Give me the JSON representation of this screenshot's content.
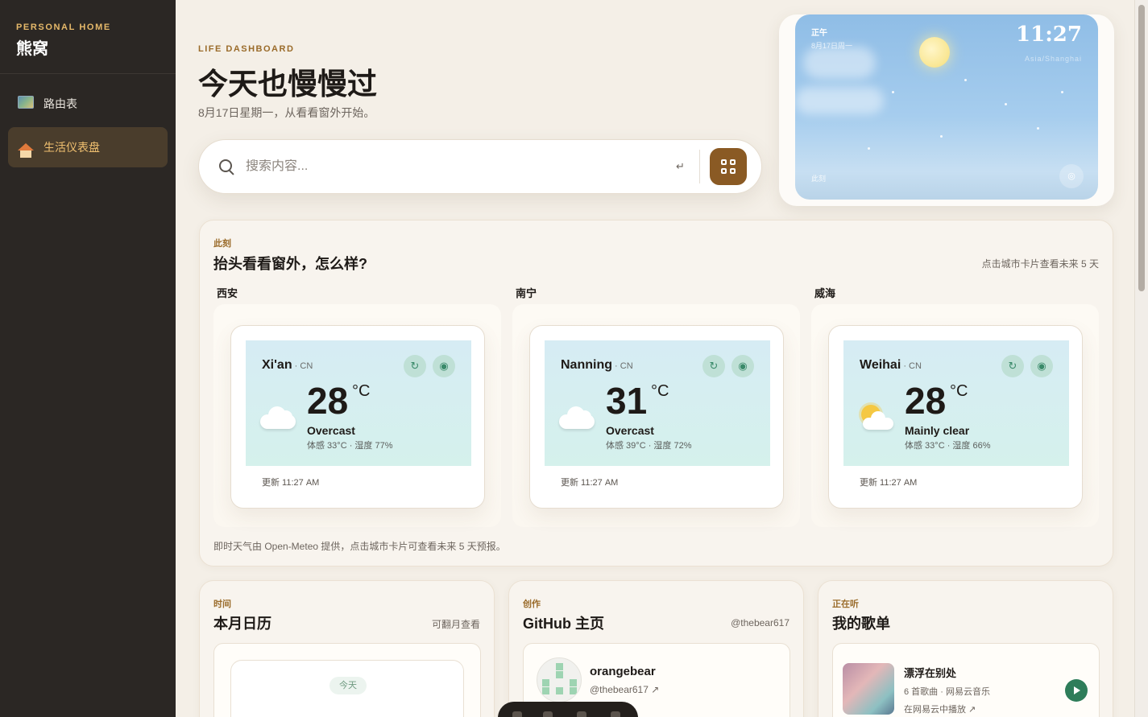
{
  "sidebar": {
    "brand_sub": "PERSONAL HOME",
    "brand_name": "熊窝",
    "items": [
      {
        "label": "路由表",
        "icon": "map-icon",
        "active": false
      },
      {
        "label": "生活仪表盘",
        "icon": "house-icon",
        "active": true
      }
    ]
  },
  "hero": {
    "kicker": "LIFE DASHBOARD",
    "title": "今天也慢慢过",
    "subtitle": "8月17日星期一，从看看窗外开始。"
  },
  "search": {
    "placeholder": "搜索内容...",
    "value": "",
    "enter_glyph": "↵"
  },
  "clock": {
    "period": "正午",
    "date": "8月17日周一",
    "time": "11:27",
    "location": "Asia/Shanghai",
    "now_label": "此刻",
    "button_glyph": "◎"
  },
  "weather": {
    "kicker": "此刻",
    "title": "抬头看看窗外，怎么样?",
    "hint": "点击城市卡片查看未来 5 天",
    "footnote": "即时天气由 Open-Meteo 提供，点击城市卡片可查看未来 5 天预报。",
    "cities": [
      {
        "label": "西安",
        "city": "Xi'an",
        "country": " · CN",
        "temp": "28",
        "unit": "°C",
        "desc": "Overcast",
        "feel": "体感 33°C · 湿度 77%",
        "updated": "更新 11:27 AM",
        "icon": "cloud-icon"
      },
      {
        "label": "南宁",
        "city": "Nanning",
        "country": " · CN",
        "temp": "31",
        "unit": "°C",
        "desc": "Overcast",
        "feel": "体感 39°C · 湿度 72%",
        "updated": "更新 11:27 AM",
        "icon": "cloud-icon"
      },
      {
        "label": "威海",
        "city": "Weihai",
        "country": " · CN",
        "temp": "28",
        "unit": "°C",
        "desc": "Mainly clear",
        "feel": "体感 33°C · 湿度 66%",
        "updated": "更新 11:27 AM",
        "icon": "sun-cloud-icon"
      }
    ],
    "refresh_glyph": "↻",
    "settings_glyph": "◉"
  },
  "calendar": {
    "kicker": "时间",
    "title": "本月日历",
    "hint": "可翻月查看",
    "today_label": "今天"
  },
  "github": {
    "kicker": "创作",
    "title": "GitHub 主页",
    "hint": "@thebear617",
    "name": "orangebear",
    "handle": "@thebear617 ↗"
  },
  "music": {
    "kicker": "正在听",
    "title": "我的歌单",
    "song_title": "漂浮在别处",
    "song_meta": "6 首歌曲 · 网易云音乐",
    "song_link": "在网易云中播放 ↗"
  },
  "colors": {
    "accent": "#8a5a24",
    "sidebar_bg": "#2b2724",
    "active_nav": "#f0c070",
    "play_green": "#2e7d5a"
  }
}
